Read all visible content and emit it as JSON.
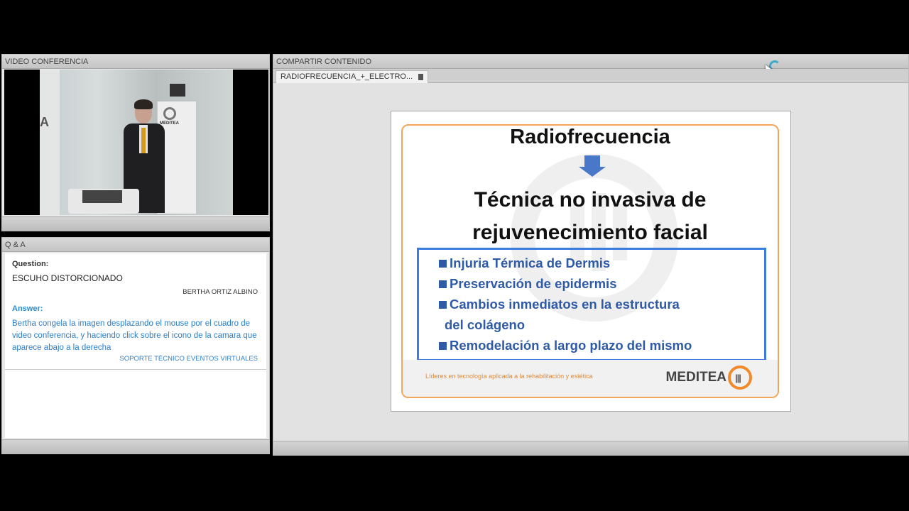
{
  "video_panel": {
    "title": "VIDEO CONFERENCIA"
  },
  "qa_panel": {
    "title": "Q & A",
    "question_label": "Question:",
    "question": "ESCUHO DISTORCIONADO",
    "asker": "BERTHA ORTIZ ALBINO",
    "answer_label": "Answer:",
    "answer": "Bertha congela la imagen desplazando el mouse por el cuadro de video conferencia, y haciendo click sobre el icono de la camara que aparece abajo a la derecha",
    "responder": "SOPORTE TÉCNICO EVENTOS VIRTUALES"
  },
  "share_panel": {
    "title": "COMPARTIR CONTENIDO",
    "doc_tab": "RADIOFRECUENCIA_+_ELECTRO..."
  },
  "slide": {
    "title": "Radiofrecuencia",
    "subtitle_line1": "Técnica no invasiva de",
    "subtitle_line2": "rejuvenecimiento facial",
    "bullets": [
      "Injuria Térmica de Dermis",
      "Preservación de epidermis",
      "Cambios inmediatos en la estructura",
      "del colágeno",
      "Remodelación a largo plazo del mismo"
    ],
    "footer_text": "Líderes en tecnología aplicada a la rehabilitación y estética",
    "brand": "MEDITEA"
  },
  "video_scene": {
    "banner_brand": "MEDITEA",
    "wall_letter": "A"
  },
  "colors": {
    "accent_blue": "#2e7fc8",
    "slide_orange": "#f2a65a",
    "bullet_blue": "#2f5aa6"
  }
}
